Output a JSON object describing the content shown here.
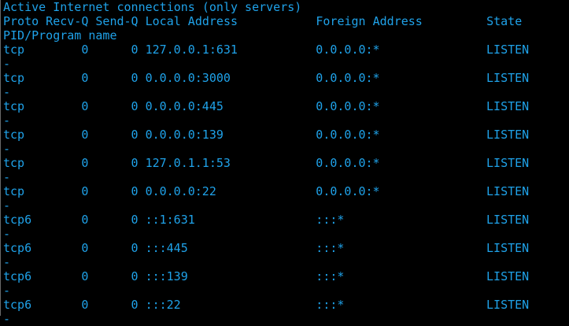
{
  "title": "Active Internet connections (only servers)",
  "header_line": "Proto Recv-Q Send-Q Local Address           Foreign Address         State",
  "header_wrap": "PID/Program name",
  "rows": [
    {
      "proto": "tcp",
      "recv_q": "0",
      "send_q": "0",
      "local": "127.0.0.1:631",
      "foreign": "0.0.0.0:*",
      "state": "LISTEN",
      "pid": "-"
    },
    {
      "proto": "tcp",
      "recv_q": "0",
      "send_q": "0",
      "local": "0.0.0.0:3000",
      "foreign": "0.0.0.0:*",
      "state": "LISTEN",
      "pid": "-"
    },
    {
      "proto": "tcp",
      "recv_q": "0",
      "send_q": "0",
      "local": "0.0.0.0:445",
      "foreign": "0.0.0.0:*",
      "state": "LISTEN",
      "pid": "-"
    },
    {
      "proto": "tcp",
      "recv_q": "0",
      "send_q": "0",
      "local": "0.0.0.0:139",
      "foreign": "0.0.0.0:*",
      "state": "LISTEN",
      "pid": "-"
    },
    {
      "proto": "tcp",
      "recv_q": "0",
      "send_q": "0",
      "local": "127.0.1.1:53",
      "foreign": "0.0.0.0:*",
      "state": "LISTEN",
      "pid": "-"
    },
    {
      "proto": "tcp",
      "recv_q": "0",
      "send_q": "0",
      "local": "0.0.0.0:22",
      "foreign": "0.0.0.0:*",
      "state": "LISTEN",
      "pid": "-"
    },
    {
      "proto": "tcp6",
      "recv_q": "0",
      "send_q": "0",
      "local": "::1:631",
      "foreign": ":::*",
      "state": "LISTEN",
      "pid": "-"
    },
    {
      "proto": "tcp6",
      "recv_q": "0",
      "send_q": "0",
      "local": ":::445",
      "foreign": ":::*",
      "state": "LISTEN",
      "pid": "-"
    },
    {
      "proto": "tcp6",
      "recv_q": "0",
      "send_q": "0",
      "local": ":::139",
      "foreign": ":::*",
      "state": "LISTEN",
      "pid": "-"
    },
    {
      "proto": "tcp6",
      "recv_q": "0",
      "send_q": "0",
      "local": ":::22",
      "foreign": ":::*",
      "state": "LISTEN",
      "pid": "-"
    }
  ]
}
